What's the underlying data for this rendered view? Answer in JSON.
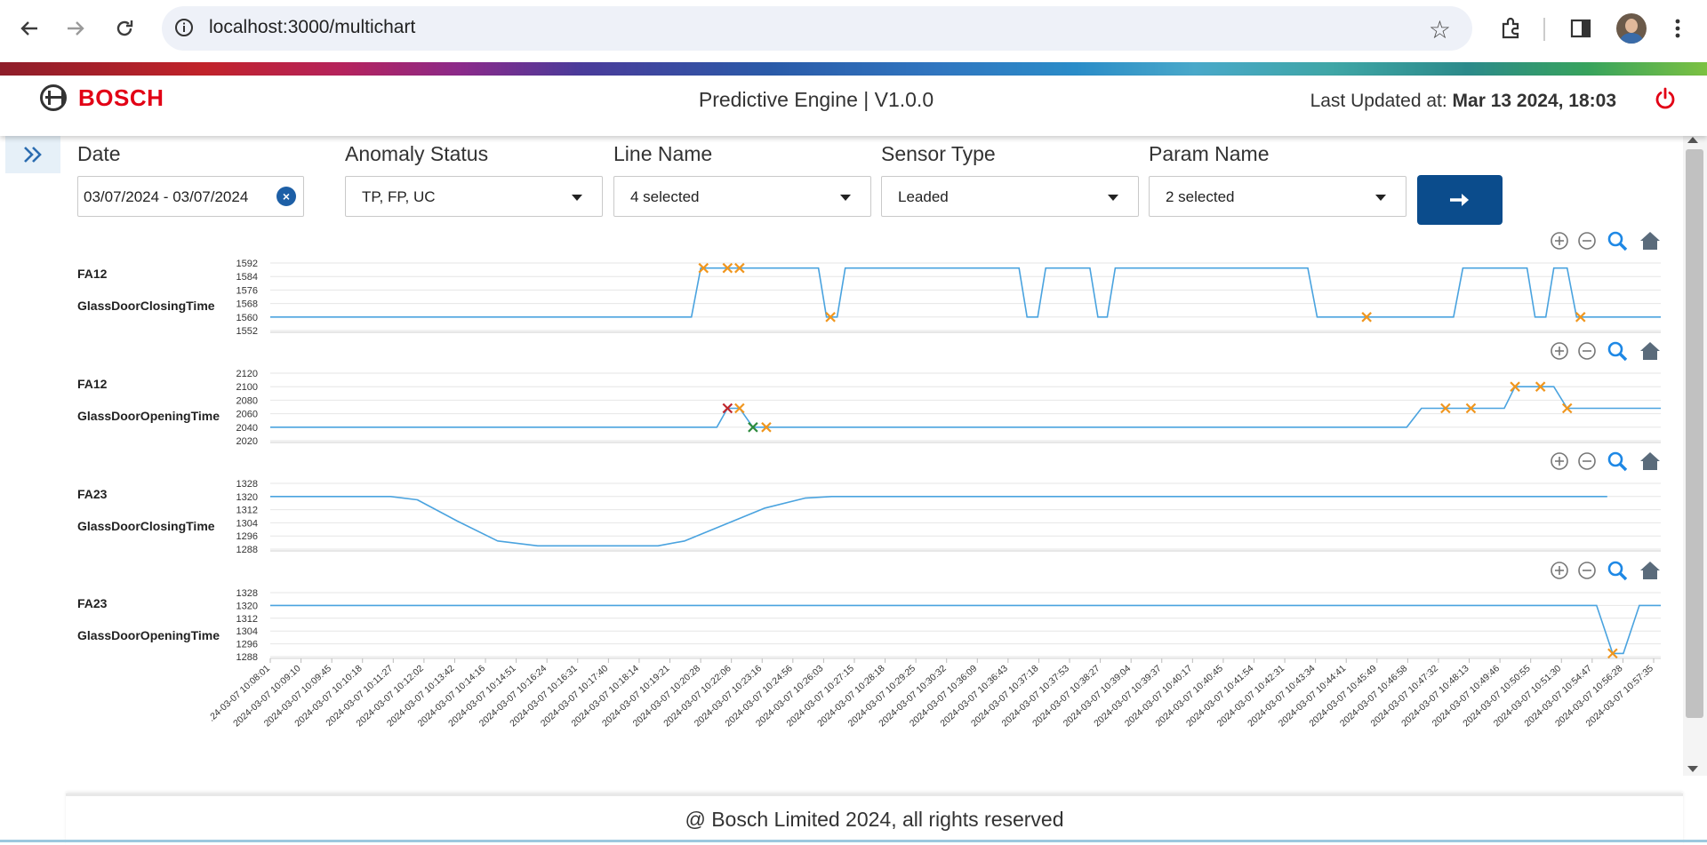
{
  "browser": {
    "url": "localhost:3000/multichart",
    "icons": [
      "back-arrow-icon",
      "forward-arrow-icon",
      "reload-icon",
      "site-info-icon",
      "bookmark-star-icon",
      "extensions-icon",
      "side-panel-icon",
      "profile-avatar",
      "kebab-menu-icon"
    ]
  },
  "header": {
    "brand": "BOSCH",
    "title": "Predictive Engine | V1.0.0",
    "last_updated_label": "Last Updated at:",
    "last_updated_value": "Mar 13 2024, 18:03",
    "colors": {
      "brand_red": "#e20015",
      "accent_blue": "#0b4c8c",
      "line_blue": "#4aa3df",
      "marker_orange": "#f0961e"
    }
  },
  "filters": {
    "date": {
      "label": "Date",
      "value": "03/07/2024 - 03/07/2024"
    },
    "anomaly_status": {
      "label": "Anomaly Status",
      "value": "TP, FP, UC"
    },
    "line_name": {
      "label": "Line Name",
      "value": "4 selected"
    },
    "sensor_type": {
      "label": "Sensor Type",
      "value": "Leaded"
    },
    "param_name": {
      "label": "Param Name",
      "value": "2 selected"
    }
  },
  "chart_tools": [
    "zoom-in-icon",
    "zoom-out-icon",
    "magnify-icon",
    "home-icon"
  ],
  "chart_data": [
    {
      "type": "line",
      "title": "FA12",
      "ylabel": "GlassDoorClosingTime",
      "yticks": [
        1592,
        1584,
        1576,
        1568,
        1560,
        1552
      ],
      "ylim": [
        1552,
        1592
      ],
      "series": [
        {
          "values": [
            [
              0,
              1560
            ],
            [
              31.5,
              1560
            ],
            [
              32.2,
              1589
            ],
            [
              41,
              1589
            ],
            [
              41.6,
              1560
            ],
            [
              42.4,
              1560
            ],
            [
              43,
              1589
            ],
            [
              56,
              1589
            ],
            [
              56.6,
              1560
            ],
            [
              57.4,
              1560
            ],
            [
              58,
              1589
            ],
            [
              61.3,
              1589
            ],
            [
              61.9,
              1560
            ],
            [
              62.6,
              1560
            ],
            [
              63.2,
              1589
            ],
            [
              77.6,
              1589
            ],
            [
              78.3,
              1560
            ],
            [
              88.5,
              1560
            ],
            [
              89.2,
              1589
            ],
            [
              94,
              1589
            ],
            [
              94.6,
              1560
            ],
            [
              95.4,
              1560
            ],
            [
              96,
              1589
            ],
            [
              97,
              1589
            ],
            [
              97.7,
              1560
            ],
            [
              104,
              1560
            ]
          ]
        }
      ],
      "anomalies": [
        {
          "x": 32.4,
          "y": 1589,
          "color": "orange"
        },
        {
          "x": 34.2,
          "y": 1589,
          "color": "orange"
        },
        {
          "x": 35.1,
          "y": 1589,
          "color": "orange"
        },
        {
          "x": 41.9,
          "y": 1560,
          "color": "orange"
        },
        {
          "x": 82,
          "y": 1560,
          "color": "orange"
        },
        {
          "x": 98,
          "y": 1560,
          "color": "orange"
        }
      ]
    },
    {
      "type": "line",
      "title": "FA12",
      "ylabel": "GlassDoorOpeningTime",
      "yticks": [
        2120,
        2100,
        2080,
        2060,
        2040,
        2020
      ],
      "ylim": [
        2020,
        2120
      ],
      "series": [
        {
          "values": [
            [
              0,
              2040
            ],
            [
              33.4,
              2040
            ],
            [
              34.2,
              2068
            ],
            [
              35.1,
              2068
            ],
            [
              36.1,
              2040
            ],
            [
              85,
              2040
            ],
            [
              86.1,
              2068
            ],
            [
              92.3,
              2068
            ],
            [
              93.1,
              2100
            ],
            [
              96,
              2100
            ],
            [
              97,
              2068
            ],
            [
              104,
              2068
            ]
          ]
        }
      ],
      "anomalies": [
        {
          "x": 34.2,
          "y": 2068,
          "color": "red"
        },
        {
          "x": 35.1,
          "y": 2068,
          "color": "orange"
        },
        {
          "x": 36.1,
          "y": 2040,
          "color": "green"
        },
        {
          "x": 37.1,
          "y": 2040,
          "color": "orange"
        },
        {
          "x": 87.9,
          "y": 2068,
          "color": "orange"
        },
        {
          "x": 89.8,
          "y": 2068,
          "color": "orange"
        },
        {
          "x": 93.1,
          "y": 2100,
          "color": "orange"
        },
        {
          "x": 95,
          "y": 2100,
          "color": "orange"
        },
        {
          "x": 97,
          "y": 2068,
          "color": "orange"
        }
      ]
    },
    {
      "type": "line",
      "title": "FA23",
      "ylabel": "GlassDoorClosingTime",
      "yticks": [
        1328,
        1320,
        1312,
        1304,
        1296,
        1288
      ],
      "ylim": [
        1288,
        1328
      ],
      "series": [
        {
          "values": [
            [
              0,
              1320
            ],
            [
              9,
              1320
            ],
            [
              11,
              1318
            ],
            [
              14,
              1305
            ],
            [
              17,
              1293
            ],
            [
              20,
              1290
            ],
            [
              29,
              1290
            ],
            [
              31,
              1293
            ],
            [
              34,
              1303
            ],
            [
              37,
              1313
            ],
            [
              40,
              1319
            ],
            [
              42,
              1320
            ],
            [
              100,
              1320
            ]
          ]
        }
      ],
      "anomalies": []
    },
    {
      "type": "line",
      "title": "FA23",
      "ylabel": "GlassDoorOpeningTime",
      "yticks": [
        1328,
        1320,
        1312,
        1304,
        1296,
        1288
      ],
      "ylim": [
        1288,
        1328
      ],
      "series": [
        {
          "values": [
            [
              0,
              1320
            ],
            [
              99.2,
              1320
            ],
            [
              100.4,
              1290
            ],
            [
              101.2,
              1290
            ],
            [
              102.4,
              1320
            ],
            [
              104,
              1320
            ]
          ]
        }
      ],
      "anomalies": [
        {
          "x": 100.4,
          "y": 1290,
          "color": "orange"
        }
      ]
    }
  ],
  "x_axis": {
    "tick_labels": [
      ".24-03-07 10:08:01",
      "2024-03-07 10:09:10",
      "2024-03-07 10:09:45",
      "2024-03-07 10:10:18",
      "2024-03-07 10:11:27",
      "2024-03-07 10:12:02",
      "2024-03-07 10:13:42",
      "2024-03-07 10:14:16",
      "2024-03-07 10:14:51",
      "2024-03-07 10:16:24",
      "2024-03-07 10:16:31",
      "2024-03-07 10:17:40",
      "2024-03-07 10:18:14",
      "2024-03-07 10:19:21",
      "2024-03-07 10:20:28",
      "2024-03-07 10:22:06",
      "2024-03-07 10:23:16",
      "2024-03-07 10:24:56",
      "2024-03-07 10:26:03",
      "2024-03-07 10:27:15",
      "2024-03-07 10:28:18",
      "2024-03-07 10:29:25",
      "2024-03-07 10:30:32",
      "2024-03-07 10:36:09",
      "2024-03-07 10:36:43",
      "2024-03-07 10:37:18",
      "2024-03-07 10:37:53",
      "2024-03-07 10:38:27",
      "2024-03-07 10:39:04",
      "2024-03-07 10:39:37",
      "2024-03-07 10:40:17",
      "2024-03-07 10:40:45",
      "2024-03-07 10:41:54",
      "2024-03-07 10:42:31",
      "2024-03-07 10:43:34",
      "2024-03-07 10:44:41",
      "2024-03-07 10:45:49",
      "2024-03-07 10:46:58",
      "2024-03-07 10:47:32",
      "2024-03-07 10:48:13",
      "2024-03-07 10:49:46",
      "2024-03-07 10:50:55",
      "2024-03-07 10:51:30",
      "2024-03-07 10:54:47",
      "2024-03-07 10:56:28",
      "2024-03-07 10:57:35"
    ]
  },
  "footer": {
    "text": "@ Bosch Limited 2024, all rights reserved"
  }
}
